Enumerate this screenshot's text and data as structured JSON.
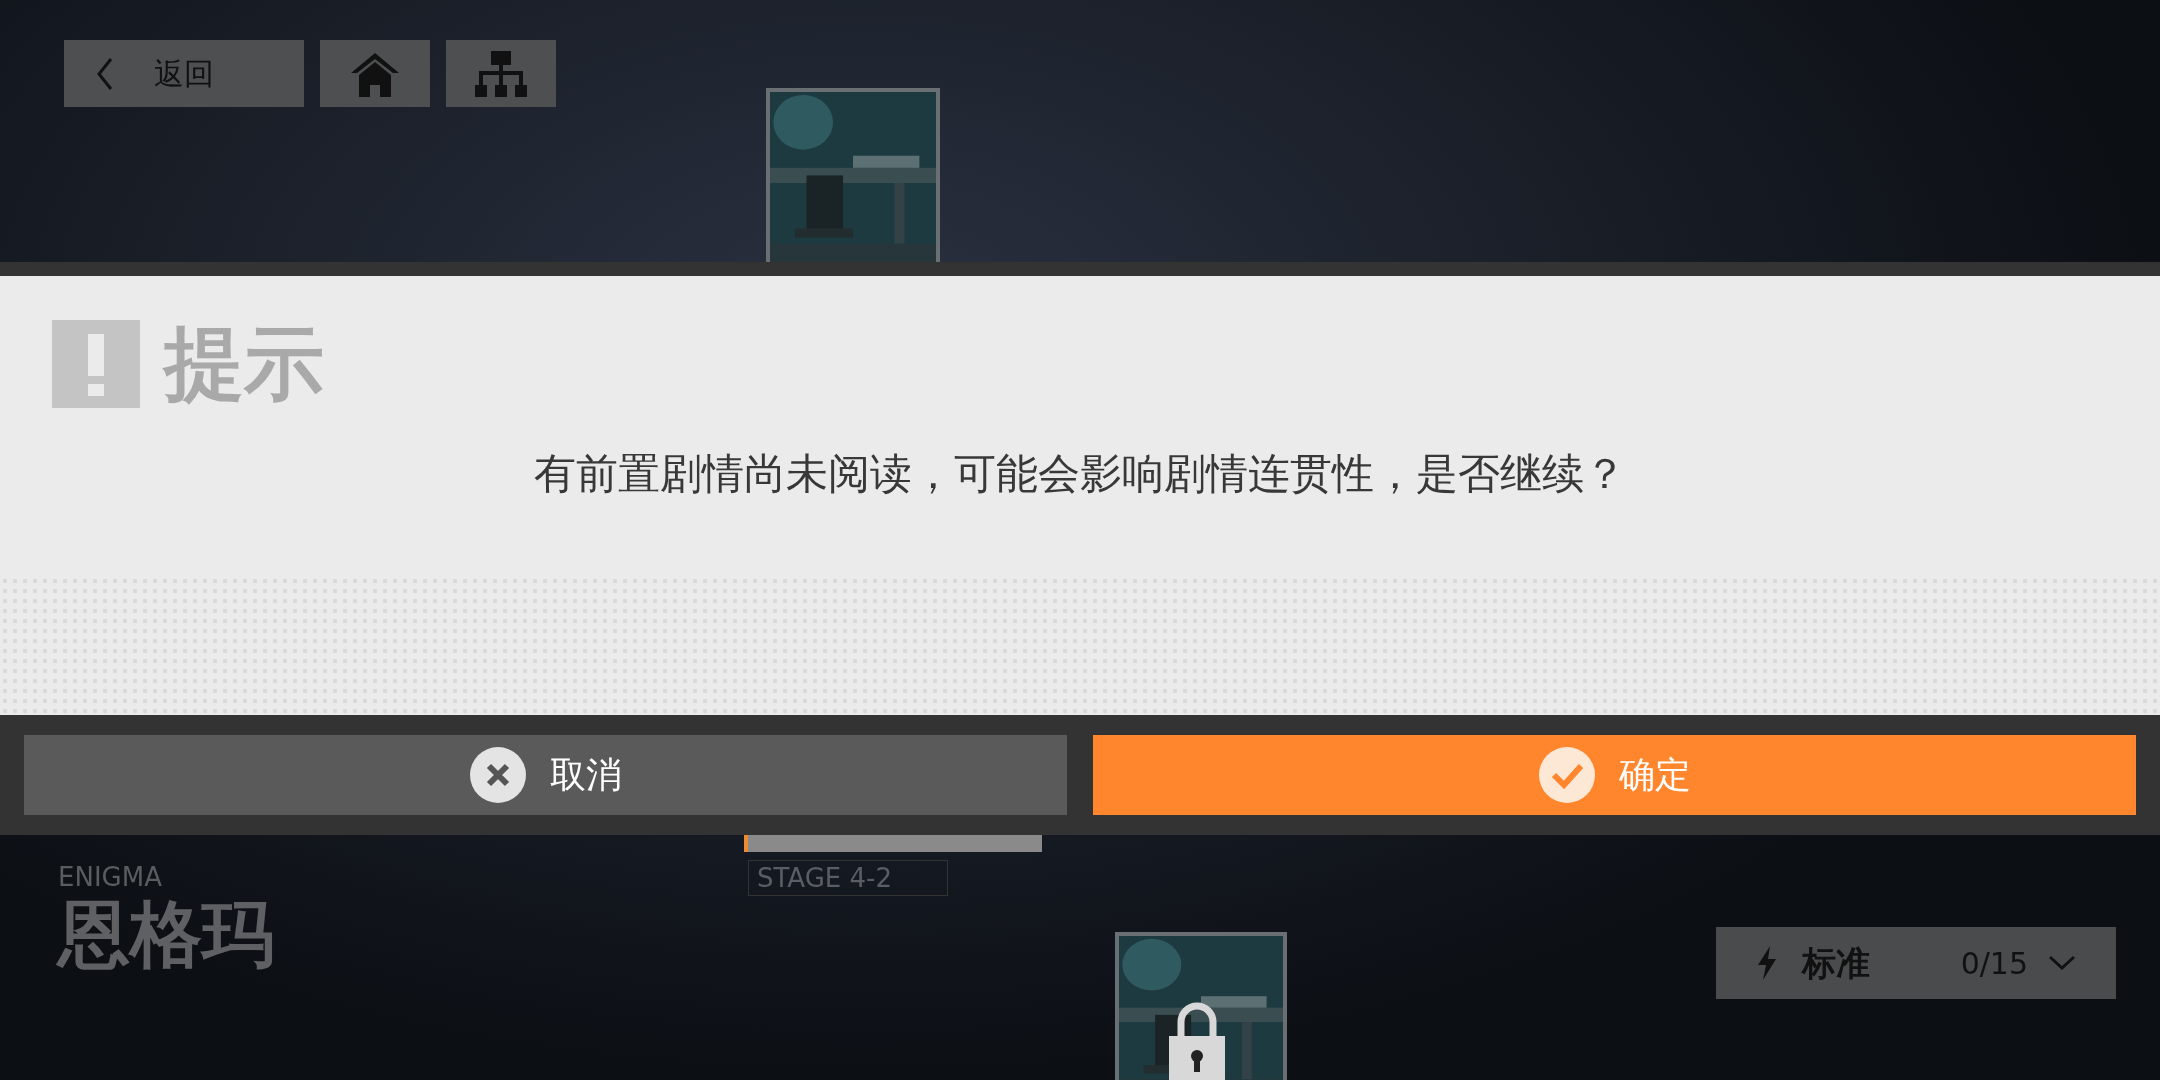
{
  "nav": {
    "back_label": "返回"
  },
  "map": {
    "stage_label": "STAGE 4-2",
    "cards": [
      {
        "locked": false
      },
      {
        "locked": true
      }
    ]
  },
  "chapter": {
    "subtitle": "ENIGMA",
    "title": "恩格玛"
  },
  "difficulty": {
    "label": "标准",
    "count": "0/15"
  },
  "dialog": {
    "title": "提示",
    "message": "有前置剧情尚未阅读，可能会影响剧情连贯性，是否继续？",
    "buttons": [
      {
        "kind": "cancel",
        "label": "取消"
      },
      {
        "kind": "confirm",
        "label": "确定"
      }
    ]
  }
}
